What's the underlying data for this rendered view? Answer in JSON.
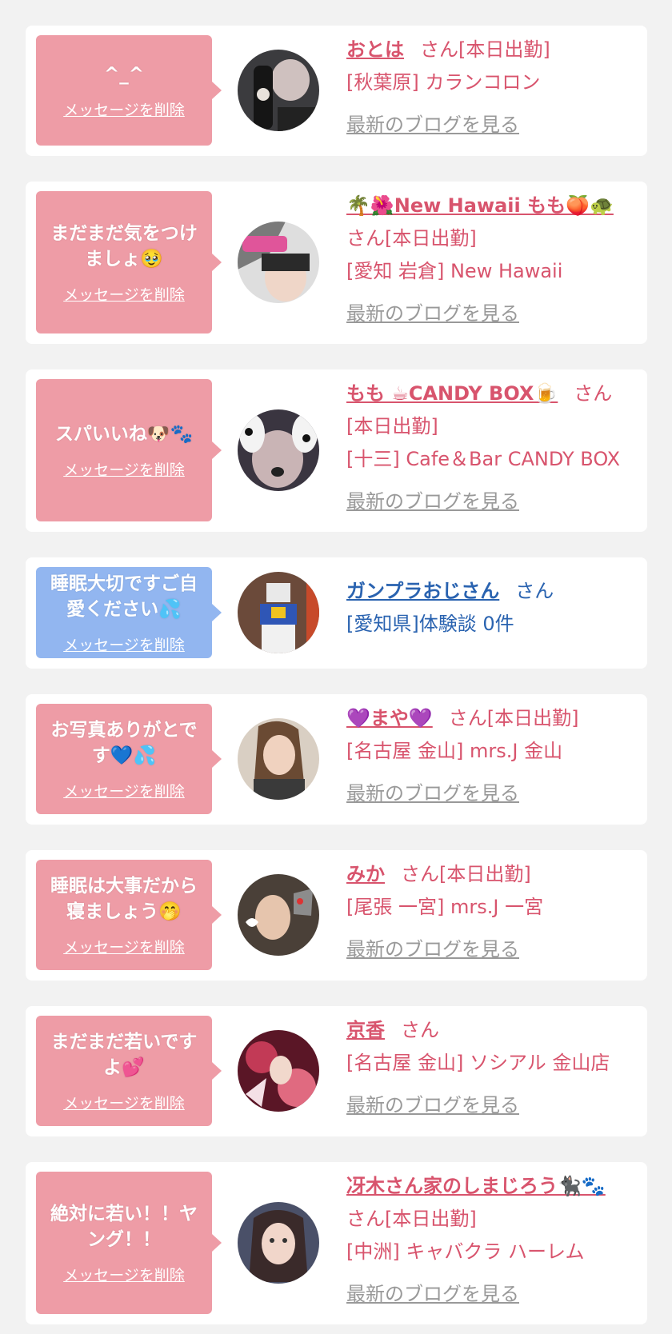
{
  "delete_label": "メッセージを削除",
  "blog_label": "最新のブログを見る",
  "san_suffix": "さん",
  "colors": {
    "accent_pink": "#d8546d",
    "bubble_pink": "#ee9ca6",
    "bubble_blue": "#92b6f0",
    "accent_blue": "#2a63b0",
    "link_gray": "#999999"
  },
  "items": [
    {
      "message": "^_^",
      "name": "おとは",
      "status": "[本日出勤]",
      "shop": "[秋葉原] カランコロン",
      "has_blog": true,
      "theme": "pink"
    },
    {
      "message": "まだまだ気をつけましょ🥹",
      "name": "🌴🌺New Hawaii もも🍑🐢",
      "status": "[本日出勤]",
      "shop": "[愛知 岩倉] New Hawaii",
      "has_blog": true,
      "theme": "pink"
    },
    {
      "message": "スパいいね🐶🐾",
      "name": "もも ☕CANDY BOX🍺",
      "status": "[本日出勤]",
      "shop": "[十三] Cafe＆Bar CANDY BOX",
      "has_blog": true,
      "theme": "pink"
    },
    {
      "message": "睡眠大切ですご自愛ください💦",
      "name": "ガンプラおじさん",
      "status": "",
      "shop": "[愛知県]体験談 0件",
      "has_blog": false,
      "theme": "blue"
    },
    {
      "message": "お写真ありがとです💙💦",
      "name": "💜まや💜",
      "status": "[本日出勤]",
      "shop": "[名古屋 金山] mrs.J 金山",
      "has_blog": true,
      "theme": "pink"
    },
    {
      "message": "睡眠は大事だから寝ましょう🤭",
      "name": "みか",
      "status": "[本日出勤]",
      "shop": "[尾張 一宮] mrs.J 一宮",
      "has_blog": true,
      "theme": "pink"
    },
    {
      "message": "まだまだ若いですよ💕",
      "name": "京香",
      "status": "",
      "shop": "[名古屋 金山] ソシアル 金山店",
      "has_blog": true,
      "theme": "pink"
    },
    {
      "message": "絶対に若い！！ヤング！！",
      "name": "冴木さん家のしまじろう🐈‍⬛🐾",
      "status": "[本日出勤]",
      "shop": "[中洲] キャバクラ ハーレム",
      "has_blog": true,
      "theme": "pink"
    }
  ]
}
